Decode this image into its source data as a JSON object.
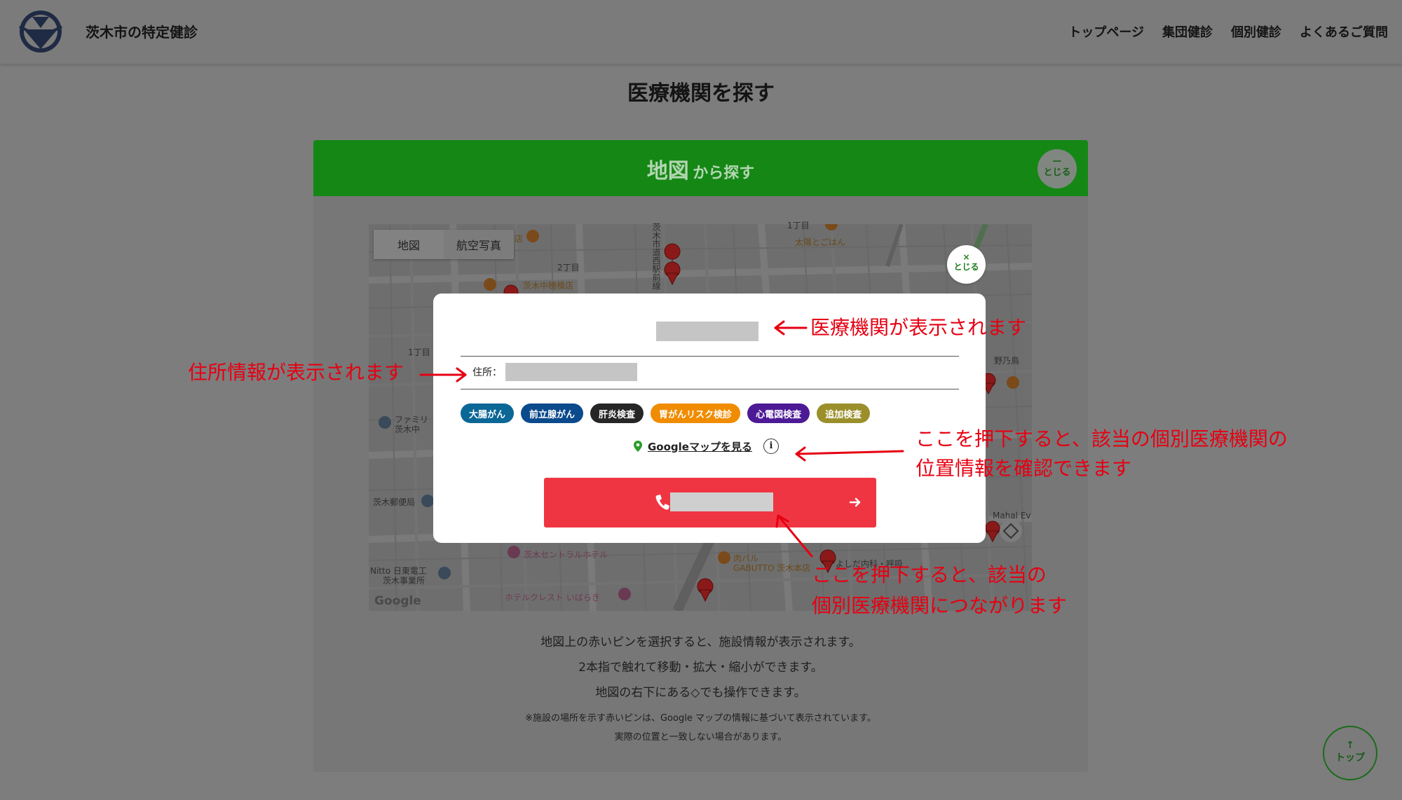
{
  "header": {
    "site_title": "茨木市の特定健診",
    "nav": [
      "トップページ",
      "集団健診",
      "個別健診",
      "よくあるご質問"
    ]
  },
  "page_title": "医療機関を探す",
  "map_section": {
    "title_main": "地図",
    "title_sub": "から探す",
    "toggle_symbol": "ー",
    "toggle_label": "とじる"
  },
  "map": {
    "type_tabs": [
      "地図",
      "航空写真"
    ],
    "google_logo": "Google",
    "labels": [
      "2丁目",
      "茨木中穂積店",
      "茨木市道西駅前線",
      "1丁目",
      "太陽とごはん",
      "ファミリ",
      "茨木中",
      "野乃鳥",
      "茨木郵便局",
      "Nitto 日東電工",
      "茨木事業所",
      "茨木セントラルホテル",
      "肉バル",
      "GABUTTO 茨木本店",
      "ホテルクレスト いばらき",
      "よしだ内科・呼吸",
      "Mahal Ev",
      "1丁目",
      "店"
    ]
  },
  "popup": {
    "close_symbol": "×",
    "close_label": "とじる",
    "address_label": "住所：",
    "tags": [
      {
        "label": "大腸がん",
        "color": "#0b6796"
      },
      {
        "label": "前立腺がん",
        "color": "#0b4a8c"
      },
      {
        "label": "肝炎検査",
        "color": "#262626"
      },
      {
        "label": "胃がんリスク検診",
        "color": "#f08c00"
      },
      {
        "label": "心電図検査",
        "color": "#4d1a96"
      },
      {
        "label": "追加検査",
        "color": "#9a8f2b"
      }
    ],
    "google_map_link": "Googleマップを見る",
    "info_symbol": "i"
  },
  "annotations": {
    "name": "医療機関が表示されます",
    "address": "住所情報が表示されます",
    "map_line1": "ここを押下すると、該当の個別医療機関の",
    "map_line2": "位置情報を確認できます",
    "call_line1": "ここを押下すると、該当の",
    "call_line2": "個別医療機関につながります"
  },
  "instructions": {
    "line1": "地図上の赤いピンを選択すると、施設情報が表示されます。",
    "line2": "2本指で触れて移動・拡大・縮小ができます。",
    "line3": "地図の右下にある◇でも操作できます。",
    "note1": "※施設の場所を示す赤いピンは、Google マップの情報に基づいて表示されています。",
    "note2": "実際の位置と一致しない場合があります。"
  },
  "top_button": {
    "arrow": "↑",
    "label": "トップ"
  },
  "colors": {
    "overlay": "#7d7d7d",
    "green": "#158715",
    "call_red": "#f03542",
    "annotation_red": "#e60012"
  }
}
